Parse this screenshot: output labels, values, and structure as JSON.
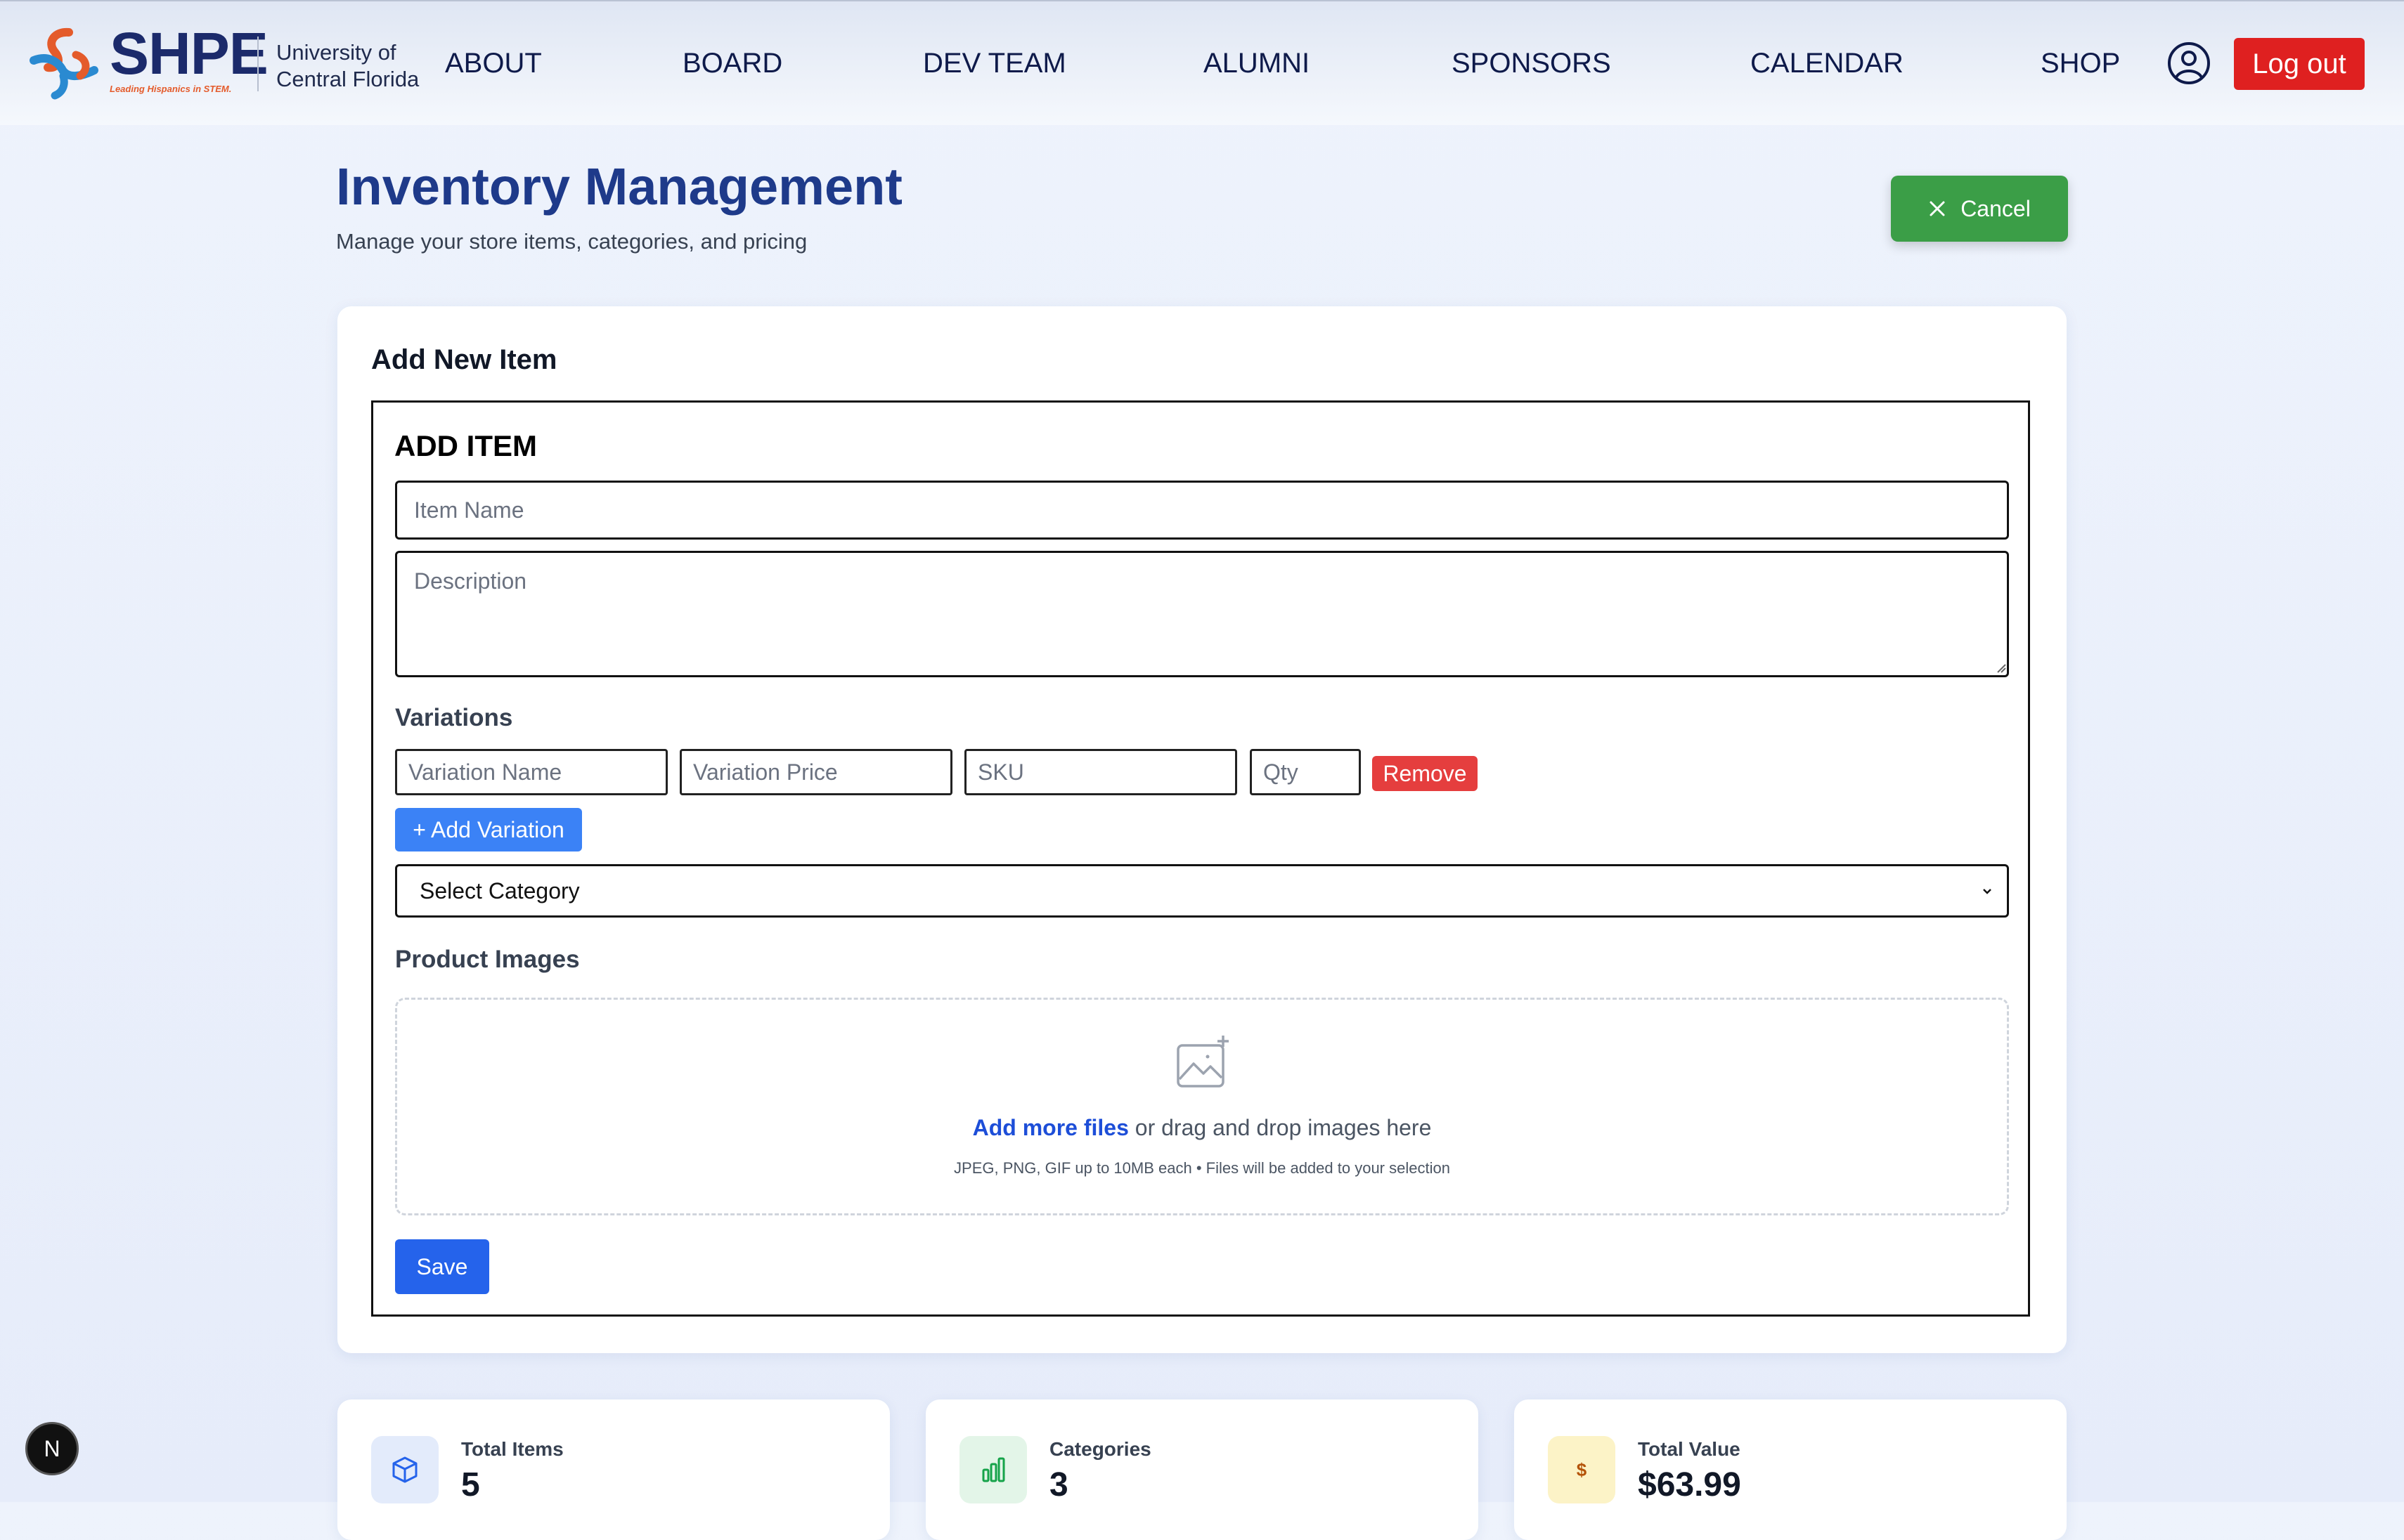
{
  "nav": {
    "brand": "SHPE",
    "tagline": "Leading Hispanics in STEM.",
    "university_line1": "University of",
    "university_line2": "Central Florida",
    "links": [
      "ABOUT",
      "BOARD",
      "DEV TEAM",
      "ALUMNI",
      "SPONSORS",
      "CALENDAR",
      "SHOP"
    ],
    "logout_label": "Log out",
    "user_icon": "user-circle-icon"
  },
  "page": {
    "title": "Inventory Management",
    "subtitle": "Manage your store items, categories, and pricing",
    "cancel_label": "Cancel"
  },
  "form": {
    "card_title": "Add New Item",
    "title": "ADD ITEM",
    "item_name_placeholder": "Item Name",
    "description_placeholder": "Description",
    "variations_label": "Variations",
    "variation": {
      "name_placeholder": "Variation Name",
      "price_placeholder": "Variation Price",
      "sku_placeholder": "SKU",
      "qty_placeholder": "Qty",
      "remove_label": "Remove"
    },
    "add_variation_label": "+ Add Variation",
    "category_selected": "Select Category",
    "images_label": "Product Images",
    "upload_link": "Add more files",
    "upload_text": " or drag and drop images here",
    "upload_note": "JPEG, PNG, GIF up to 10MB each • Files will be added to your selection",
    "save_label": "Save"
  },
  "stats": [
    {
      "label": "Total Items",
      "value": "5",
      "icon": "cube-icon",
      "icon_color": "#2563eb",
      "bg": "#e3ebfb"
    },
    {
      "label": "Categories",
      "value": "3",
      "icon": "bar-chart-icon",
      "icon_color": "#16a34a",
      "bg": "#e3f5e8"
    },
    {
      "label": "Total Value",
      "value": "$63.99",
      "icon": "dollar-icon",
      "icon_color": "#b45309",
      "bg": "#fcf3c7"
    }
  ],
  "dev_badge": "N",
  "colors": {
    "primary_navy": "#1e3a8a",
    "logout_red": "#df2020",
    "cancel_green": "#3b9e47",
    "save_blue": "#2563eb",
    "add_variation_blue": "#3b82f6",
    "remove_red": "#e53e3e"
  }
}
